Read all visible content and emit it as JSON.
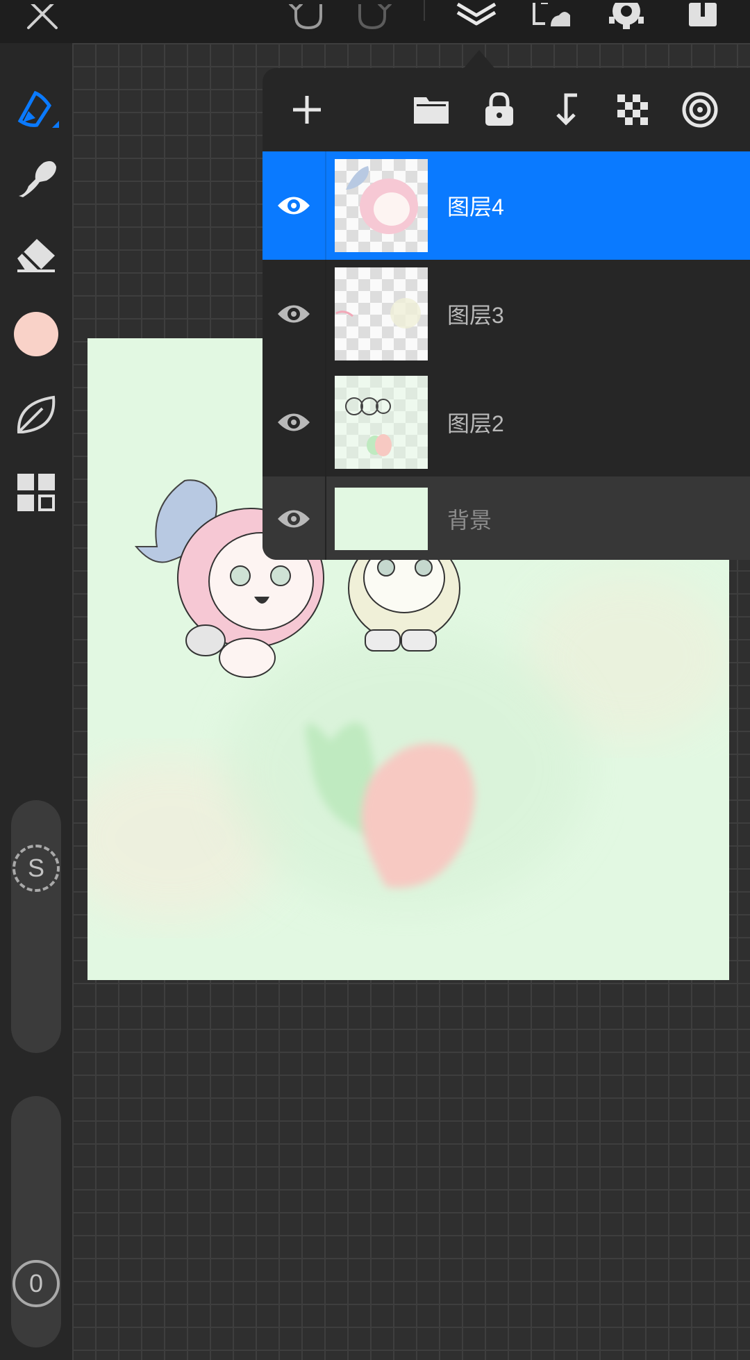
{
  "toolbar": {
    "close_icon": "close-icon",
    "undo_icon": "undo-icon",
    "redo_icon": "redo-icon",
    "layers_icon": "layers-icon",
    "transform_icon": "transform-icon",
    "settings_icon": "gear-icon",
    "export_icon": "export-icon"
  },
  "sidebar": {
    "tools": [
      "pen-icon",
      "smudge-icon",
      "eraser-icon",
      "color-swatch",
      "leaf-icon",
      "gallery-icon"
    ],
    "active_color": "#f9d2c8",
    "accent": "#0a7aff",
    "brush_size_knob": "S",
    "opacity_knob": "0"
  },
  "layers_panel": {
    "actions": [
      "add-icon",
      "folder-icon",
      "lock-icon",
      "merge-down-icon",
      "alpha-lock-icon",
      "target-icon"
    ],
    "layers": [
      {
        "name": "图层4",
        "visible": true,
        "selected": true
      },
      {
        "name": "图层3",
        "visible": true,
        "selected": false
      },
      {
        "name": "图层2",
        "visible": true,
        "selected": false
      },
      {
        "name": "背景",
        "visible": true,
        "selected": false
      }
    ]
  }
}
